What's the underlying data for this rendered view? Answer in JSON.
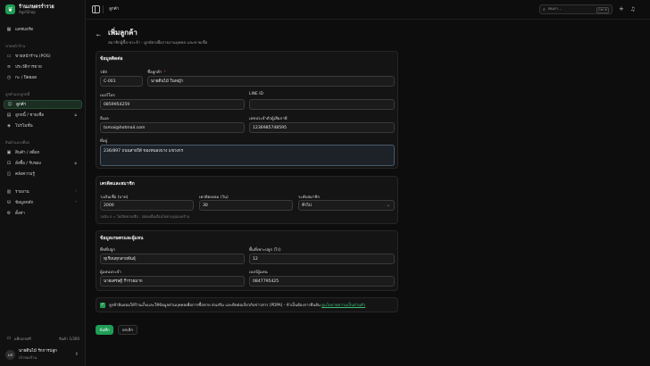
{
  "brand": {
    "name": "ร้านเกษตรร่ำรวย",
    "sub": "AgriShop",
    "logo_icon": "leaf-icon"
  },
  "sidebar": {
    "top_items": [
      {
        "label": "แดชบอร์ด",
        "icon": "grid-icon"
      }
    ],
    "sections": [
      {
        "title": "ขายหน้าร้าน",
        "items": [
          {
            "label": "ขายหน้าร้าน (POS)",
            "icon": "monitor-icon"
          },
          {
            "label": "ประวัติการขาย",
            "icon": "list-icon"
          },
          {
            "label": "กะ / ปิดยอด",
            "icon": "clock-icon"
          }
        ]
      },
      {
        "title": "ลูกค้าและลูกหนี้",
        "items": [
          {
            "label": "ลูกค้า",
            "icon": "user-icon"
          },
          {
            "label": "ลูกหนี้ / ชายเชื่อ",
            "icon": "wallet-icon"
          },
          {
            "label": "โปรโมชั่น",
            "icon": "tag-icon"
          }
        ]
      },
      {
        "title": "สินค้าและสต็อก",
        "items": [
          {
            "label": "สินค้า / สต็อก",
            "icon": "box-icon"
          },
          {
            "label": "สั่งซื้อ / รับของ",
            "icon": "cart-icon"
          },
          {
            "label": "คลังความรู้",
            "icon": "book-icon"
          }
        ]
      },
      {
        "title": "",
        "items": [
          {
            "label": "รายงาน",
            "icon": "chart-icon"
          },
          {
            "label": "ข้อมูลหลัก",
            "icon": "database-icon"
          },
          {
            "label": "ตั้งค่า",
            "icon": "gear-icon"
          }
        ]
      }
    ],
    "package": {
      "label": "แพ็กเกจฟรี",
      "value": "สินค้า 1/300"
    },
    "user": {
      "initials": "มส",
      "name": "นายดินไม้ รักการปลูก",
      "role": "เจ้าของร้าน"
    }
  },
  "topbar": {
    "title": "ลูกค้า",
    "search_placeholder": "ค้นหา...",
    "shortcut": "Ctrl K"
  },
  "page": {
    "title": "เพิ่มลูกค้า",
    "subtitle": "สมาชิกผู้ซื้อ-ประจำ - ผูกบัตรเพื่อรายงานบุคคล และขายเชื่อ"
  },
  "contact": {
    "title": "ข้อมูลติดต่อ",
    "code_label": "รหัส",
    "code_value": "C-001",
    "name_label": "ชื่อลูกค้า",
    "name_required": "*",
    "name_value": "นายดินไม้ ในหญ้า",
    "phone_label": "เบอร์โทร",
    "phone_value": "0859954259",
    "line_label": "LINE ID",
    "line_value": "",
    "email_label": "อีเมล",
    "email_value": "tomai@hotmail.com",
    "taxid_label": "เลขประจำตัวผู้เสียภาษี",
    "taxid_value": "1236985748595",
    "address_label": "ที่อยู่",
    "address_value": "236/897 ถนนสายใต้ ของหนองบาง แขวงกร"
  },
  "credit": {
    "title": "เครดิตและสมาชิก",
    "limit_label": "วงเงินเชื่อ (บาท)",
    "limit_value": "2000",
    "days_label": "เครดิตเทอม (วัน)",
    "days_value": "30",
    "tier_label": "ระดับสมาชิก",
    "tier_value": "ทั่วไป",
    "hint": "วงเงิน 0 = ไม่เปิดขายเชื่อ - ปล่อยเต็มเงื่อนไขตามรูปแบบร้าน"
  },
  "farm": {
    "title": "ข้อมูลเกษตรและผู้แทน",
    "crop_label": "พืชที่ปลูก",
    "crop_value": "ทุเรียนทุกสายพันธุ์",
    "area_label": "พื้นที่เพาะปลูก (ไร่)",
    "area_value": "12",
    "agent_label": "ผู้แทนประจำ",
    "agent_value": "นายเศรษฐี ร่ำรวยมาก",
    "agent_phone_label": "เบอร์ผู้แทน",
    "agent_phone_value": "0847795425"
  },
  "consent": {
    "text": "ลูกค้ายินยอมให้ร้านเก็บและใช้ข้อมูลส่วนบุคคลเพื่อการซื้อขาย ส่งเสริม และติดต่อเกี่ยวกับข่าวสาร (PDPA) - ข้าเป็นต้องการยืนยัน",
    "link": "ดูนโยบายความเป็นส่วนตัว"
  },
  "actions": {
    "save": "บันทึก",
    "cancel": "ยกเลิก"
  },
  "colors": {
    "accent": "#1f9d55",
    "required": "#e04b4b",
    "bg": "#0d0d0d"
  }
}
